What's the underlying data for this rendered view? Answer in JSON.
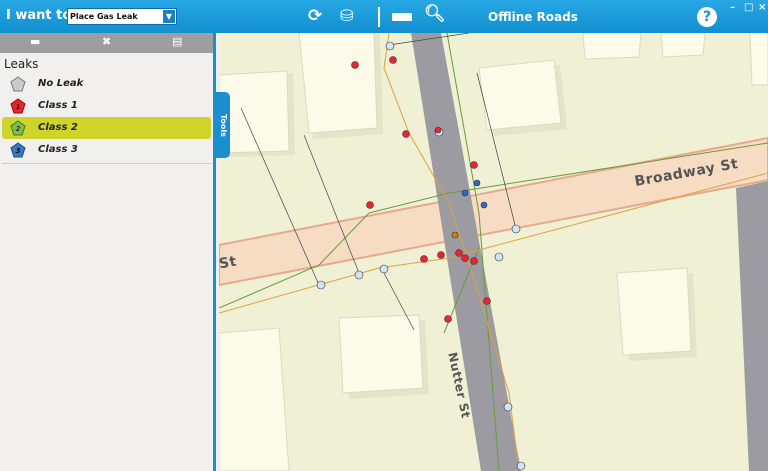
{
  "toolbar": {
    "i_want_to_label": "I want to:",
    "task_select_value": "Place Gas Leak",
    "map_title": "Offline Roads",
    "help_label": "?",
    "minimize": "–",
    "maximize": "□",
    "close": "×"
  },
  "panel": {
    "tab_icons": [
      "layers-icon",
      "tools-icon",
      "search-layer-icon"
    ],
    "heading": "Leaks",
    "items": [
      {
        "label": "No Leak",
        "num": "",
        "color": "#c9ccce"
      },
      {
        "label": "Class 1",
        "num": "1",
        "color": "#e0262b"
      },
      {
        "label": "Class 2",
        "num": "2",
        "color": "#7cc242"
      },
      {
        "label": "Class 3",
        "num": "3",
        "color": "#3b78c4"
      }
    ],
    "selected": "Class 2",
    "selected_color": "#cfd42b"
  },
  "tools_tab": "Tools",
  "map": {
    "streets": [
      "Broadway St",
      "St",
      "Nutter St"
    ]
  }
}
